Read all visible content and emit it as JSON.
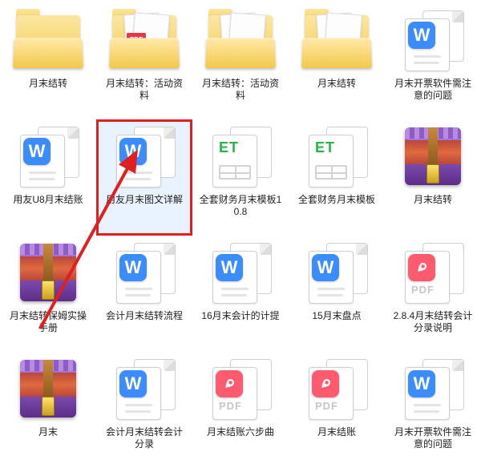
{
  "files": [
    {
      "name": "月末结转",
      "type": "folder",
      "variant": "plain"
    },
    {
      "name": "月末结转：活动资料",
      "type": "folder",
      "variant": "pdf"
    },
    {
      "name": "月末结转：活动资料",
      "type": "folder",
      "variant": "sheets"
    },
    {
      "name": "月末结转",
      "type": "folder",
      "variant": "sheets"
    },
    {
      "name": "月末开票软件需注意的问题",
      "type": "wps"
    },
    {
      "name": "用友U8月末结账",
      "type": "wps"
    },
    {
      "name": "用友月末图文详解",
      "type": "wps",
      "selected": true
    },
    {
      "name": "全套财务月末模板10.8",
      "type": "et"
    },
    {
      "name": "全套财务月末模板",
      "type": "et"
    },
    {
      "name": "月末结转",
      "type": "rar"
    },
    {
      "name": "月末结转保姆实操手册",
      "type": "rar"
    },
    {
      "name": "会计月末结转流程",
      "type": "wps"
    },
    {
      "name": "16月末会计的计提",
      "type": "wps"
    },
    {
      "name": "15月末盘点",
      "type": "wps"
    },
    {
      "name": "2.8.4月末结转会计分录说明",
      "type": "pdf"
    },
    {
      "name": "月末",
      "type": "rar"
    },
    {
      "name": "会计月末结转会计分录",
      "type": "wps"
    },
    {
      "name": "月末结账六步曲",
      "type": "pdf"
    },
    {
      "name": "月末结账",
      "type": "pdf"
    },
    {
      "name": "月末开票软件需注意的问题",
      "type": "wps"
    }
  ],
  "icon_text": {
    "wps_badge": "W",
    "et_badge": "ET",
    "pdf_label": "PDF",
    "folder_pdf_badge": "PDF"
  },
  "annotation": {
    "arrow_color": "#e02020",
    "selection_color": "#e02020"
  }
}
